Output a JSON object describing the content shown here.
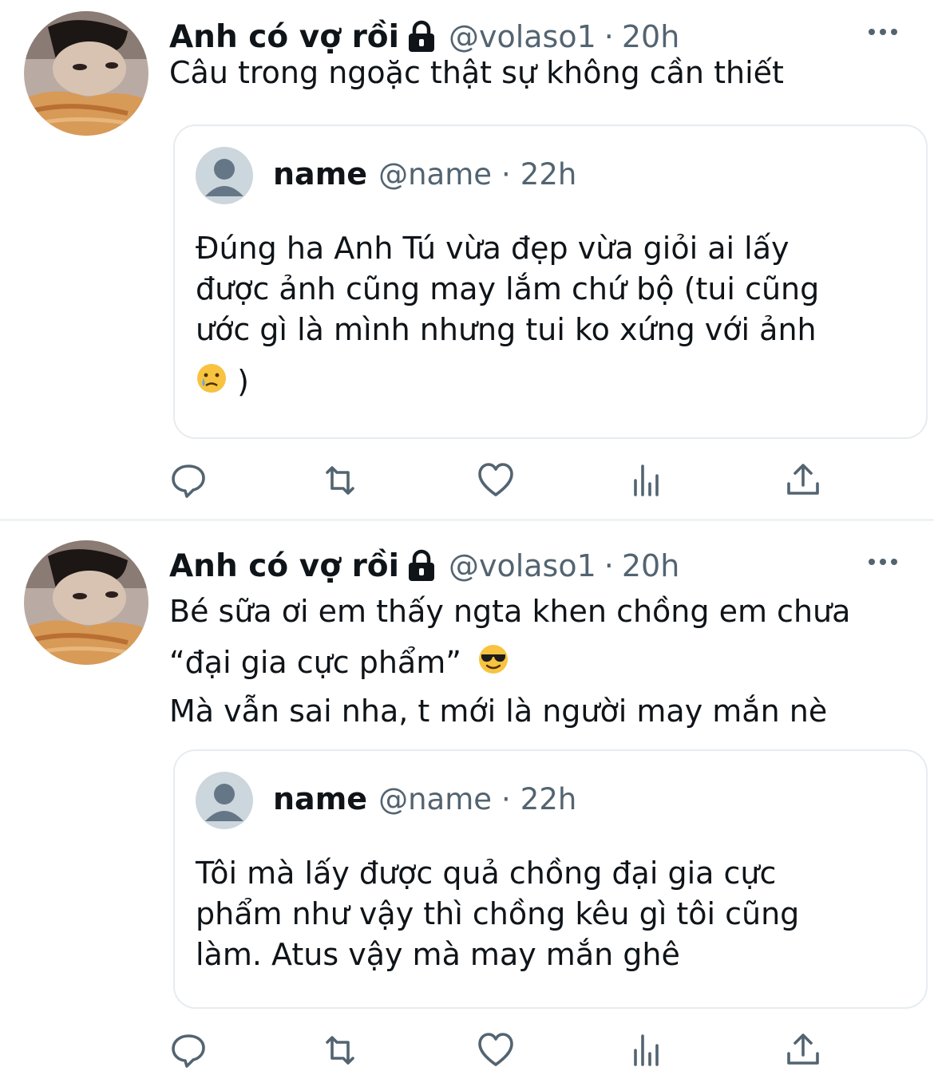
{
  "tweets": [
    {
      "author": {
        "display_name": "Anh có vợ rồi",
        "handle": "@volaso1",
        "separator": "·",
        "time": "20h"
      },
      "text_lines": [
        "Câu trong ngoặc thật sự không cần thiết"
      ],
      "quote": {
        "name": "name",
        "handle": "@name",
        "separator": "·",
        "time": "22h",
        "text_lines": [
          "Đúng ha Anh Tú vừa đẹp vừa giỏi ai lấy",
          "được ảnh cũng may lắm chứ bộ (tui cũng",
          "ước gì là mình nhưng tui ko xứng với ảnh",
          ")"
        ],
        "emoji": "crying-face"
      },
      "actions": [
        "reply-icon",
        "retweet-icon",
        "like-icon",
        "analytics-icon",
        "share-icon"
      ]
    },
    {
      "author": {
        "display_name": "Anh có vợ rồi",
        "handle": "@volaso1",
        "separator": "·",
        "time": "20h"
      },
      "text_lines": [
        "Bé sữa ơi em thấy ngta khen chồng em chưa",
        "“đại gia cực phẩm”",
        "Mà vẫn sai nha, t mới là người may mắn nè"
      ],
      "text_emoji": "sunglasses-face",
      "quote": {
        "name": "name",
        "handle": "@name",
        "separator": "·",
        "time": "22h",
        "text_lines": [
          "Tôi mà lấy được quả chồng đại gia cực",
          "phẩm như vậy thì chồng kêu gì tôi cũng",
          "làm. Atus vậy mà may mắn ghê"
        ]
      },
      "actions": [
        "reply-icon",
        "retweet-icon",
        "like-icon",
        "analytics-icon",
        "share-icon"
      ]
    }
  ],
  "colors": {
    "text": "#0f1419",
    "secondary": "#536471",
    "border": "#e6ecf0",
    "icon": "#536471"
  }
}
